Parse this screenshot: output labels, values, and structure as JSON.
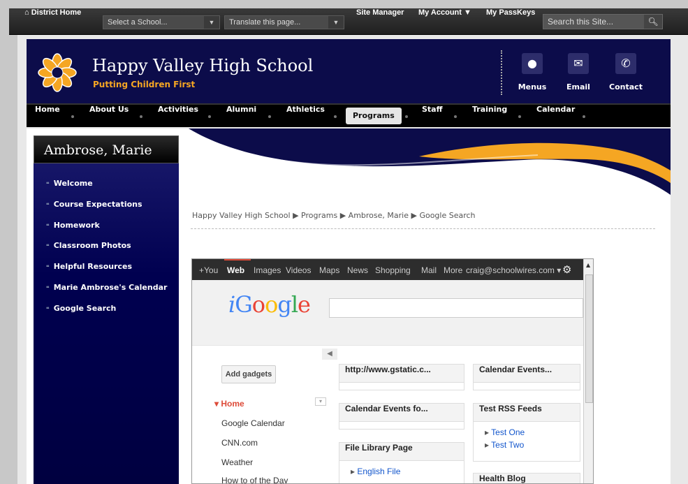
{
  "topbar": {
    "district_home": "District Home",
    "school_select": "Select a School...",
    "translate": "Translate this page...",
    "site_manager": "Site Manager",
    "my_account": "My Account",
    "my_passkeys": "My PassKeys",
    "search_placeholder": "Search this Site..."
  },
  "header": {
    "school_name": "Happy Valley High School",
    "tagline": "Putting Children First",
    "quick_links": [
      {
        "label": "Menus",
        "icon": "apple-icon"
      },
      {
        "label": "Email",
        "icon": "envelope-icon"
      },
      {
        "label": "Contact",
        "icon": "phone-icon"
      }
    ]
  },
  "nav": {
    "items": [
      "Home",
      "About Us",
      "Activities",
      "Alumni",
      "Athletics",
      "Programs",
      "Staff",
      "Training",
      "Calendar"
    ],
    "active": "Programs"
  },
  "sidebar": {
    "title": "Ambrose, Marie",
    "links": [
      "Welcome",
      "Course Expectations",
      "Homework",
      "Classroom Photos",
      "Helpful Resources",
      "Marie Ambrose's Calendar",
      "Google Search"
    ]
  },
  "breadcrumb": [
    "Happy Valley High School",
    "Programs",
    "Ambrose, Marie",
    "Google Search"
  ],
  "igoogle": {
    "bar_links": [
      "+You",
      "Web",
      "Images",
      "Videos",
      "Maps",
      "News",
      "Shopping",
      "Mail",
      "More"
    ],
    "account": "craig@schoolwires.com",
    "logo_i": "i",
    "logo_rest": "Google",
    "add_gadgets": "Add gadgets",
    "left_nav": [
      "Home",
      "Google Calendar",
      "CNN.com",
      "Weather",
      "How to of the Day"
    ],
    "gadgets_col1": [
      {
        "title": "http://www.gstatic.c...",
        "links": []
      },
      {
        "title": "Calendar Events fo...",
        "links": []
      },
      {
        "title": "File Library Page",
        "links": [
          "English File"
        ]
      }
    ],
    "gadgets_col2": [
      {
        "title": "Calendar Events...",
        "links": []
      },
      {
        "title": "Test RSS Feeds",
        "links": [
          "Test One",
          "Test Two"
        ]
      },
      {
        "title": "Health Blog",
        "links": []
      }
    ],
    "colors": {
      "blue": "#4285f4",
      "red": "#ea4335",
      "yellow": "#fbbc05",
      "green": "#34a853"
    }
  },
  "colors": {
    "navy": "#0c0c4a",
    "orange": "#f5a623"
  }
}
